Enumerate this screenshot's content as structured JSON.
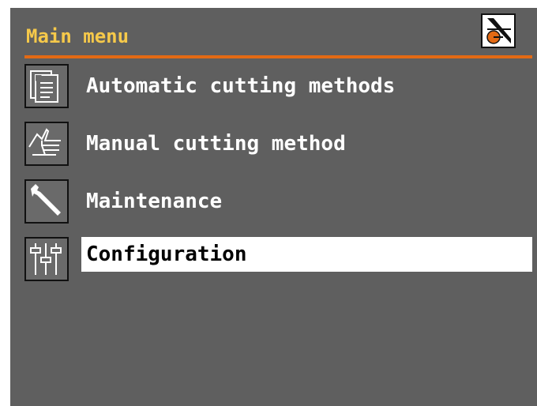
{
  "header": {
    "title": "Main menu",
    "status_icon": "cutter-status-icon",
    "accent_color": "#e36a14",
    "title_color": "#f6c94a"
  },
  "menu": {
    "items": [
      {
        "label": "Automatic cutting methods",
        "icon": "document-icon",
        "selected": false
      },
      {
        "label": "Manual cutting method",
        "icon": "hand-icon",
        "selected": false
      },
      {
        "label": "Maintenance",
        "icon": "wrench-icon",
        "selected": false
      },
      {
        "label": "Configuration",
        "icon": "sliders-icon",
        "selected": true
      }
    ]
  },
  "colors": {
    "background": "#5f5f5f",
    "text": "#ffffff",
    "selected_background": "#ffffff",
    "selected_text": "#000000"
  }
}
